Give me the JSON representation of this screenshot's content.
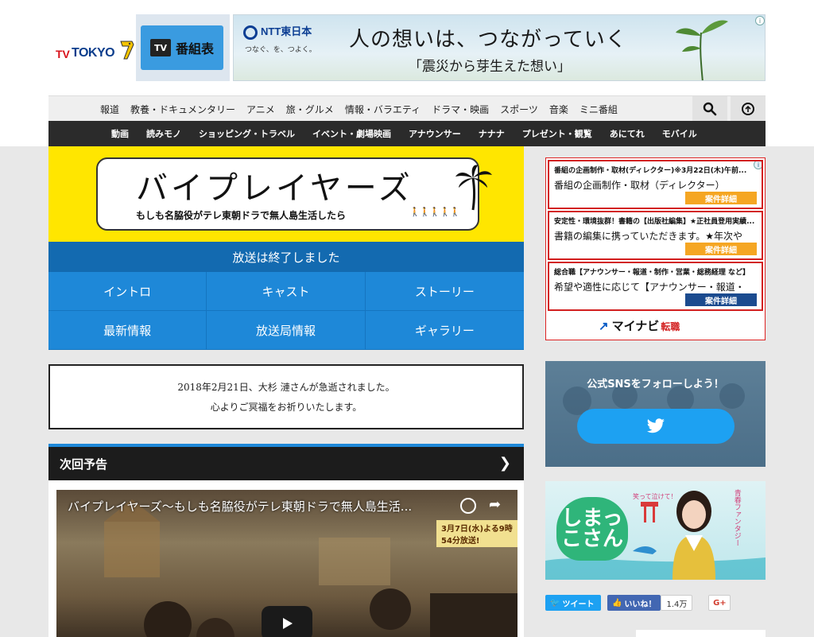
{
  "header": {
    "logo_tv": "TV",
    "logo_tokyo": "TOKYO",
    "bangumi_icon": "TV",
    "bangumi_label": "番組表"
  },
  "top_ad": {
    "brand": "NTT東日本",
    "brand_sub": "つなぐ、を、つよく。",
    "headline": "人の想いは、つながっていく",
    "subline": "「震災から芽生えた想い」",
    "info": "i"
  },
  "genre_nav": {
    "items": [
      "報道",
      "教養・ドキュメンタリー",
      "アニメ",
      "旅・グルメ",
      "情報・バラエティ",
      "ドラマ・映画",
      "スポーツ",
      "音楽",
      "ミニ番組"
    ]
  },
  "sub_nav": {
    "items": [
      "動画",
      "読みモノ",
      "ショッピング・トラベル",
      "イベント・劇場映画",
      "アナウンサー",
      "ナナナ",
      "プレゼント・観覧",
      "あにてれ",
      "モバイル"
    ]
  },
  "show": {
    "title": "バイプレイヤーズ",
    "subtitle": "もしも名脇役がテレ東朝ドラで無人島生活したら",
    "status": "放送は終了しました",
    "menu": [
      "イントロ",
      "キャスト",
      "ストーリー",
      "最新情報",
      "放送局情報",
      "ギャラリー"
    ]
  },
  "notice": {
    "line1": "2018年2月21日、大杉 漣さんが急逝されました。",
    "line2": "心よりご冥福をお祈りいたします。"
  },
  "next_preview": {
    "heading": "次回予告",
    "video_title": "バイプレイヤーズ〜もしも名脇役がテレ東朝ドラで無人島生活...",
    "badge": "3月7日(水)よる9時54分放送!"
  },
  "job_ad": {
    "adchoice": "i",
    "jobs": [
      {
        "title": "番組の企画制作・取材(ディレクター)※3月22日(木)午前...",
        "body": "番組の企画制作・取材（ディレクター）",
        "button": "案件詳細",
        "button_color": "#f5a623"
      },
      {
        "title": "安定性・環境抜群！書籍の【出版社編集】★正社員登用実績...",
        "body": "書籍の編集に携っていただきます。★年次や",
        "button": "案件詳細",
        "button_color": "#f5a623"
      },
      {
        "title": "総合職【アナウンサー・報道・制作・営業・総務経理 など】",
        "body": "希望や適性に応じて【アナウンサー・報道・",
        "button": "案件詳細",
        "button_color": "#1b4b8f"
      }
    ],
    "brand": "マイナビ",
    "brand_suffix": "転職"
  },
  "sns": {
    "text": "公式SNSをフォローしよう！"
  },
  "promo": {
    "logo": "しまっこさん",
    "small": "笑って泣けて！",
    "tag": "青春ファンタジー"
  },
  "social": {
    "tweet": "ツイート",
    "like": "いいね！",
    "like_count": "1.4万",
    "gplus": "G+"
  },
  "colors": {
    "accent_blue": "#1e88d8",
    "status_blue": "#136ab0",
    "banner_yellow": "#ffe600",
    "ad_red": "#d21f1f"
  }
}
